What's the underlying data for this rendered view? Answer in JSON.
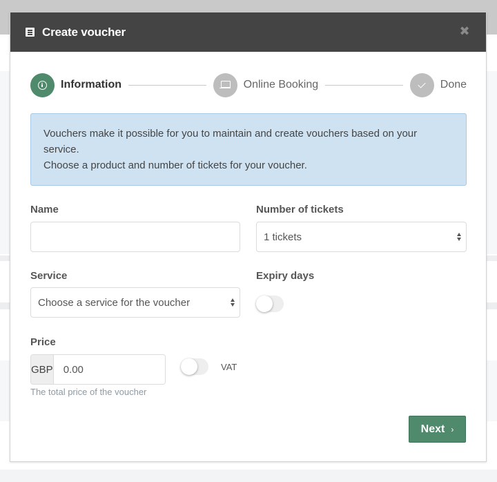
{
  "modal": {
    "title": "Create voucher",
    "title_icon": "list-icon",
    "close_icon": "close-icon"
  },
  "stepper": {
    "steps": [
      {
        "label": "Information",
        "icon": "info-icon",
        "state": "active"
      },
      {
        "label": "Online Booking",
        "icon": "laptop-icon",
        "state": "inactive"
      },
      {
        "label": "Done",
        "icon": "check-icon",
        "state": "inactive"
      }
    ]
  },
  "alert": {
    "line1": "Vouchers make it possible for you to maintain and create vouchers based on your service.",
    "line2": "Choose a product and number of tickets for your voucher."
  },
  "form": {
    "name": {
      "label": "Name",
      "value": "",
      "placeholder": ""
    },
    "tickets": {
      "label": "Number of tickets",
      "selected": "1 tickets"
    },
    "service": {
      "label": "Service",
      "selected": "Choose a service for the voucher"
    },
    "expiry": {
      "label": "Expiry days",
      "enabled": false
    },
    "price": {
      "label": "Price",
      "currency": "GBP",
      "value": "0.00",
      "help": "The total price of the voucher"
    },
    "vat": {
      "label": "VAT",
      "enabled": false
    }
  },
  "footer": {
    "next_label": "Next",
    "next_icon": "›"
  },
  "colors": {
    "primary": "#4f8a6c",
    "header": "#444444",
    "alert_bg": "#cfe2f1",
    "inactive_step": "#bdbdbd"
  }
}
